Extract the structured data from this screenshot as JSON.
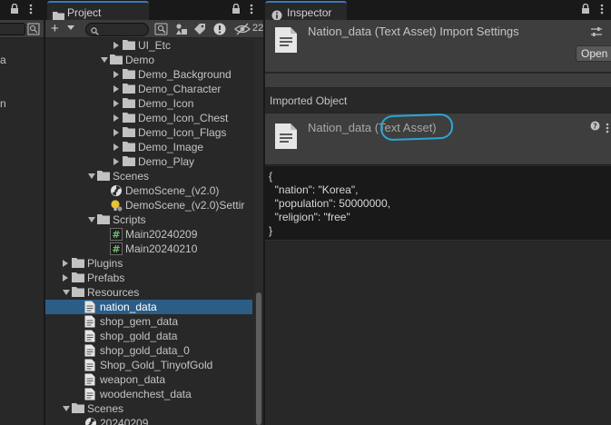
{
  "left_strip": {
    "partial_texts": [
      "a",
      "n"
    ]
  },
  "project": {
    "tab_label": "Project",
    "toolbar_count": "22"
  },
  "tree": [
    {
      "label": "UI_Etc",
      "kind": "folder",
      "arrow": "right",
      "depth": 4
    },
    {
      "label": "Demo",
      "kind": "folder",
      "arrow": "down",
      "depth": 3
    },
    {
      "label": "Demo_Background",
      "kind": "folder",
      "arrow": "right",
      "depth": 4
    },
    {
      "label": "Demo_Character",
      "kind": "folder",
      "arrow": "right",
      "depth": 4
    },
    {
      "label": "Demo_Icon",
      "kind": "folder",
      "arrow": "right",
      "depth": 4
    },
    {
      "label": "Demo_Icon_Chest",
      "kind": "folder",
      "arrow": "right",
      "depth": 4
    },
    {
      "label": "Demo_Icon_Flags",
      "kind": "folder",
      "arrow": "right",
      "depth": 4
    },
    {
      "label": "Demo_Image",
      "kind": "folder",
      "arrow": "right",
      "depth": 4
    },
    {
      "label": "Demo_Play",
      "kind": "folder",
      "arrow": "right",
      "depth": 4
    },
    {
      "label": "Scenes",
      "kind": "folder",
      "arrow": "down",
      "depth": 2
    },
    {
      "label": "DemoScene_(v2.0)",
      "kind": "scene",
      "arrow": "none",
      "depth": 3
    },
    {
      "label": "DemoScene_(v2.0)Settir",
      "kind": "settings",
      "arrow": "none",
      "depth": 3
    },
    {
      "label": "Scripts",
      "kind": "folder",
      "arrow": "down",
      "depth": 2
    },
    {
      "label": "Main20240209",
      "kind": "script",
      "arrow": "none",
      "depth": 3
    },
    {
      "label": "Main20240210",
      "kind": "script",
      "arrow": "none",
      "depth": 3
    },
    {
      "label": "Plugins",
      "kind": "folder",
      "arrow": "right",
      "depth": 0
    },
    {
      "label": "Prefabs",
      "kind": "folder",
      "arrow": "right",
      "depth": 0
    },
    {
      "label": "Resources",
      "kind": "folder",
      "arrow": "down",
      "depth": 0
    },
    {
      "label": "nation_data",
      "kind": "text",
      "arrow": "none",
      "depth": 1,
      "selected": true
    },
    {
      "label": "shop_gem_data",
      "kind": "text",
      "arrow": "none",
      "depth": 1
    },
    {
      "label": "shop_gold_data",
      "kind": "text",
      "arrow": "none",
      "depth": 1
    },
    {
      "label": "shop_gold_data_0",
      "kind": "text",
      "arrow": "none",
      "depth": 1
    },
    {
      "label": "Shop_Gold_TinyofGold",
      "kind": "text",
      "arrow": "none",
      "depth": 1
    },
    {
      "label": "weapon_data",
      "kind": "text",
      "arrow": "none",
      "depth": 1
    },
    {
      "label": "woodenchest_data",
      "kind": "text",
      "arrow": "none",
      "depth": 1
    },
    {
      "label": "Scenes",
      "kind": "folder",
      "arrow": "down",
      "depth": 0
    },
    {
      "label": "20240209",
      "kind": "scene",
      "arrow": "none",
      "depth": 1
    }
  ],
  "inspector": {
    "tab_label": "Inspector",
    "import_title": "Nation_data (Text Asset) Import Settings",
    "open_label": "Open",
    "imported_object_label": "Imported Object",
    "object_title": "Nation_data (Text Asset)",
    "help_glyph": "?",
    "code_lines": [
      "{",
      "  \"nation\": \"Korea\",",
      "  \"population\": 50000000,",
      "  \"religion\": \"free\"",
      "}"
    ]
  },
  "colors": {
    "selection": "#2c5d87",
    "tab_accent": "#3a79bb",
    "annotation_circle": "#2aa7d6"
  }
}
